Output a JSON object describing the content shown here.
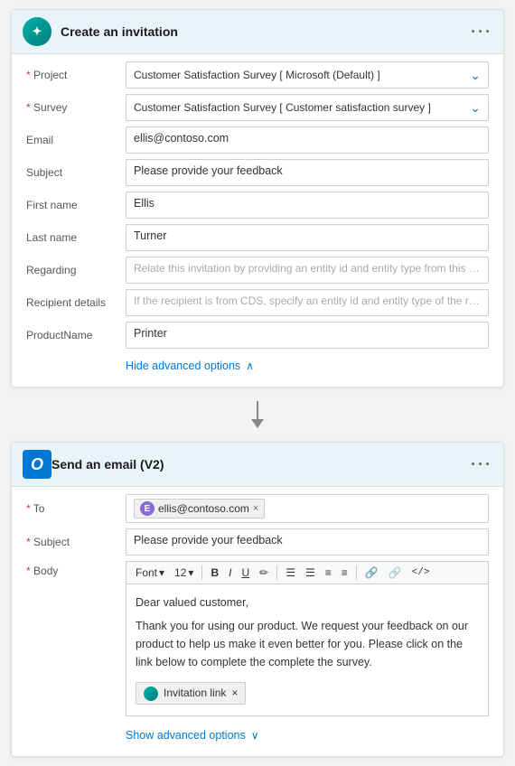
{
  "card1": {
    "title": "Create an invitation",
    "icon": "teal",
    "menu_label": "···",
    "fields": [
      {
        "label": "Project",
        "required": true,
        "value": "Customer Satisfaction Survey [ Microsoft (Default) ]",
        "type": "dropdown"
      },
      {
        "label": "Survey",
        "required": true,
        "value": "Customer Satisfaction Survey [ Customer satisfaction survey ]",
        "type": "dropdown"
      },
      {
        "label": "Email",
        "required": false,
        "value": "ellis@contoso.com",
        "type": "text"
      },
      {
        "label": "Subject",
        "required": false,
        "value": "Please provide your feedback",
        "type": "text"
      },
      {
        "label": "First name",
        "required": false,
        "value": "Ellis",
        "type": "text"
      },
      {
        "label": "Last name",
        "required": false,
        "value": "Turner",
        "type": "text"
      },
      {
        "label": "Regarding",
        "required": false,
        "value": "Relate this invitation by providing an entity id and entity type from this CDS in t",
        "type": "text"
      },
      {
        "label": "Recipient details",
        "required": false,
        "value": "If the recipient is from CDS, specify an entity id and entity type of the recipient",
        "type": "text"
      },
      {
        "label": "ProductName",
        "required": false,
        "value": "Printer",
        "type": "text"
      }
    ],
    "advanced_toggle": "Hide advanced options",
    "advanced_chevron": "∧"
  },
  "card2": {
    "title": "Send an email (V2)",
    "icon": "blue",
    "menu_label": "···",
    "to_label": "To",
    "to_required": true,
    "to_tag": {
      "initial": "E",
      "value": "ellis@contoso.com"
    },
    "subject_label": "Subject",
    "subject_required": true,
    "subject_value": "Please provide your feedback",
    "body_label": "Body",
    "body_required": true,
    "toolbar": {
      "font": "Font",
      "size": "12",
      "bold": "B",
      "italic": "I",
      "underline": "U",
      "highlight": "🖊",
      "list_ol": "≡",
      "list_ul": "≡",
      "indent_left": "≡",
      "indent_right": "≡",
      "link": "⛓",
      "unlink": "⛓",
      "code": "</>"
    },
    "body_lines": [
      "Dear valued customer,",
      "",
      "Thank you for using our product. We request your feedback on our product to help us make it even better for you. Please click on the link below to complete the complete the survey."
    ],
    "invitation_tag": "Invitation link",
    "show_advanced": "Show advanced options",
    "show_chevron": "∨"
  }
}
